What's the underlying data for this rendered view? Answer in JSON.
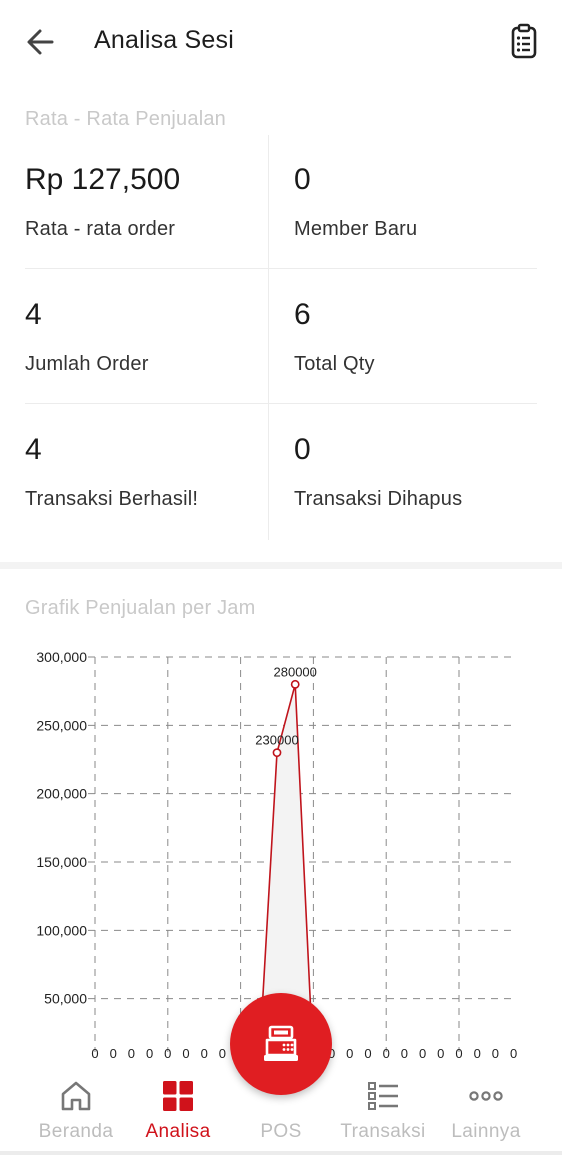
{
  "header": {
    "title": "Analisa Sesi",
    "back_icon": "arrow-left-icon",
    "action_icon": "clipboard-list-icon"
  },
  "stats_section": {
    "label": "Rata - Rata Penjualan",
    "items": [
      {
        "value": "Rp 127,500",
        "label": "Rata - rata order"
      },
      {
        "value": "0",
        "label": "Member Baru"
      },
      {
        "value": "4",
        "label": "Jumlah Order"
      },
      {
        "value": "6",
        "label": "Total Qty"
      },
      {
        "value": "4",
        "label": "Transaksi Berhasil!"
      },
      {
        "value": "0",
        "label": "Transaksi Dihapus"
      }
    ]
  },
  "chart_section": {
    "label": "Grafik Penjualan per Jam"
  },
  "chart_data": {
    "type": "area",
    "title": "Grafik Penjualan per Jam",
    "x": [
      0,
      1,
      2,
      3,
      4,
      5,
      6,
      7,
      8,
      9,
      10,
      11,
      12,
      13,
      14,
      15,
      16,
      17,
      18,
      19,
      20,
      21,
      22,
      23
    ],
    "series": [
      {
        "values": [
          0,
          0,
          0,
          0,
          0,
          0,
          0,
          0,
          0,
          0,
          230000,
          280000,
          0,
          0,
          0,
          0,
          0,
          0,
          0,
          0,
          0,
          0,
          0,
          0
        ]
      }
    ],
    "data_labels": [
      "230000",
      "280000"
    ],
    "y_ticks": [
      "50,000",
      "100,000",
      "150,000",
      "200,000",
      "250,000",
      "300,000"
    ],
    "x_tick_labels": [
      "0",
      "0",
      "0",
      "0",
      "0",
      "0",
      "0",
      "0",
      "0",
      "0",
      "0",
      "0",
      "0",
      "0",
      "0",
      "0",
      "0",
      "0",
      "0",
      "0",
      "0",
      "0",
      "0",
      "0"
    ],
    "ylim": [
      0,
      300000
    ],
    "grid": true,
    "colors": {
      "line": "#c0141c",
      "fill": "#f3f3f3",
      "marker_fill": "#ffffff"
    }
  },
  "nav": {
    "items": [
      {
        "label": "Beranda",
        "icon": "home-icon"
      },
      {
        "label": "Analisa",
        "icon": "grid-icon",
        "active": true
      },
      {
        "label": "POS",
        "icon": "cash-register-icon"
      },
      {
        "label": "Transaksi",
        "icon": "list-icon"
      },
      {
        "label": "Lainnya",
        "icon": "more-dots-icon"
      }
    ]
  },
  "colors": {
    "accent": "#d0121b",
    "fab": "#e01e22",
    "muted_label": "#c9c9c9",
    "inactive_nav": "#bdbdbd"
  }
}
